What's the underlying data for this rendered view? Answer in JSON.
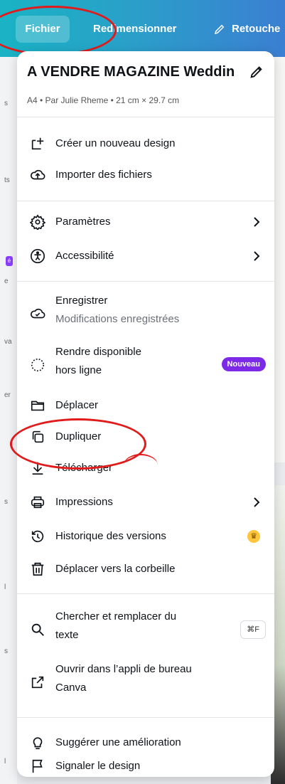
{
  "toolbar": {
    "file_label": "Fichier",
    "resize_label": "Redimensionner",
    "retouch_label": "Retouche"
  },
  "design": {
    "title": "A VENDRE MAGAZINE Weddin",
    "subtitle": "A4 • Par Julie Rheme • 21 cm × 29.7 cm"
  },
  "menu": {
    "create_new": "Créer un nouveau design",
    "import_files": "Importer des fichiers",
    "settings": "Paramètres",
    "accessibility": "Accessibilité",
    "save": "Enregistrer",
    "save_status": "Modifications enregistrées",
    "offline_line1": "Rendre disponible",
    "offline_line2": "hors ligne",
    "new_badge": "Nouveau",
    "move": "Déplacer",
    "duplicate": "Dupliquer",
    "download": "Télécharger",
    "print": "Impressions",
    "version_history": "Historique des versions",
    "trash": "Déplacer vers la corbeille",
    "find_replace_line1": "Chercher et remplacer du",
    "find_replace_line2": "texte",
    "shortcut": "⌘F",
    "open_desktop_line1": "Ouvrir dans l’appli de bureau",
    "open_desktop_line2": "Canva",
    "suggest": "Suggérer une amélioration",
    "report": "Signaler le design"
  },
  "strip_fragments": [
    "s",
    "ts",
    "é",
    "e",
    "va",
    "er",
    "s",
    "l",
    "s",
    "l"
  ],
  "colors": {
    "toolbar_start": "#19b3c4",
    "toolbar_end": "#3b7fd2",
    "badge": "#7d2ae8",
    "crown": "#ffc53d",
    "annotation": "#e01b1b"
  },
  "icons": {
    "create_new": "add-design-icon",
    "import": "cloud-upload-icon",
    "settings": "gear-icon",
    "accessibility": "accessibility-icon",
    "save": "cloud-check-icon",
    "offline": "offline-download-icon",
    "move": "folder-icon",
    "duplicate": "duplicate-icon",
    "download": "download-icon",
    "print": "printer-icon",
    "history": "history-icon",
    "trash": "trash-icon",
    "search": "search-icon",
    "external": "external-link-icon",
    "suggest": "lightbulb-icon",
    "report": "flag-icon"
  }
}
